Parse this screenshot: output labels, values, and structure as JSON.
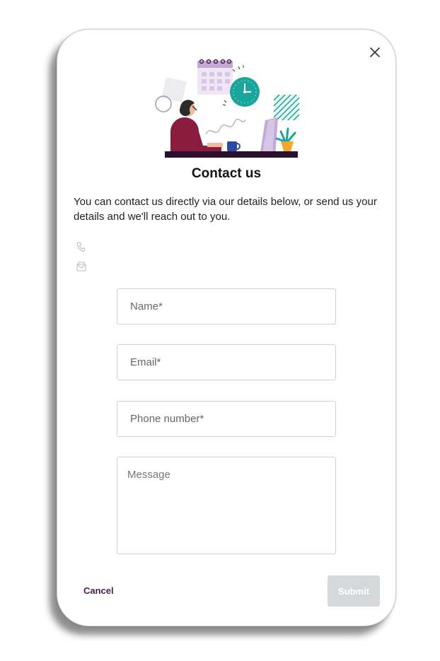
{
  "dialog": {
    "title": "Contact us",
    "intro": "You can contact us directly via our details below, or send us your details and we'll reach out to you.",
    "phone_value": "",
    "email_value": ""
  },
  "form": {
    "name_placeholder": "Name*",
    "email_placeholder": "Email*",
    "phone_placeholder": "Phone number*",
    "message_placeholder": "Message"
  },
  "actions": {
    "cancel_label": "Cancel",
    "submit_label": "Submit"
  },
  "icons": {
    "close": "close-icon",
    "phone": "phone-icon",
    "email": "email-icon"
  },
  "colors": {
    "accent": "#4a1d4f",
    "teal": "#1aa59c",
    "lavender": "#c2a9d6",
    "submit_disabled": "#d5d8db"
  }
}
